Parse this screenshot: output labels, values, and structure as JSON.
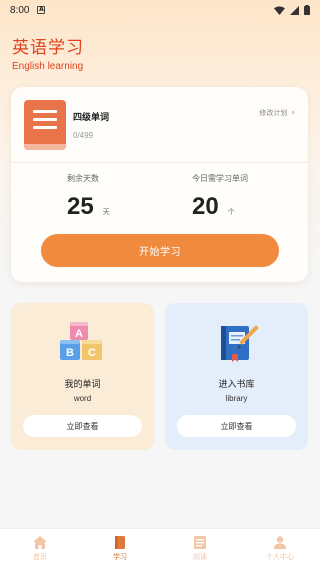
{
  "status_bar": {
    "time": "8:00"
  },
  "header": {
    "title": "英语学习",
    "subtitle": "English learning"
  },
  "study_card": {
    "book_title": "四级单词",
    "progress": "0/499",
    "edit_plan": "修改计划",
    "remaining_days": {
      "label": "剩余天数",
      "value": "25",
      "unit": "天"
    },
    "daily_words": {
      "label": "今日需学习单词",
      "value": "20",
      "unit": "个"
    },
    "start_button": "开始学习"
  },
  "features": [
    {
      "title": "我的单词",
      "subtitle": "word",
      "button": "立即查看"
    },
    {
      "title": "进入书库",
      "subtitle": "library",
      "button": "立即查看"
    }
  ],
  "tabs": [
    {
      "label": "首页",
      "icon": "home-icon",
      "active": false
    },
    {
      "label": "学习",
      "icon": "book-icon",
      "active": true
    },
    {
      "label": "阅读",
      "icon": "reading-icon",
      "active": false
    },
    {
      "label": "个人中心",
      "icon": "person-icon",
      "active": false
    }
  ],
  "colors": {
    "accent": "#ef8a3e",
    "title": "#e0431e",
    "tab_inactive": "#f3c6a8",
    "tab_active": "#e07a3a"
  }
}
